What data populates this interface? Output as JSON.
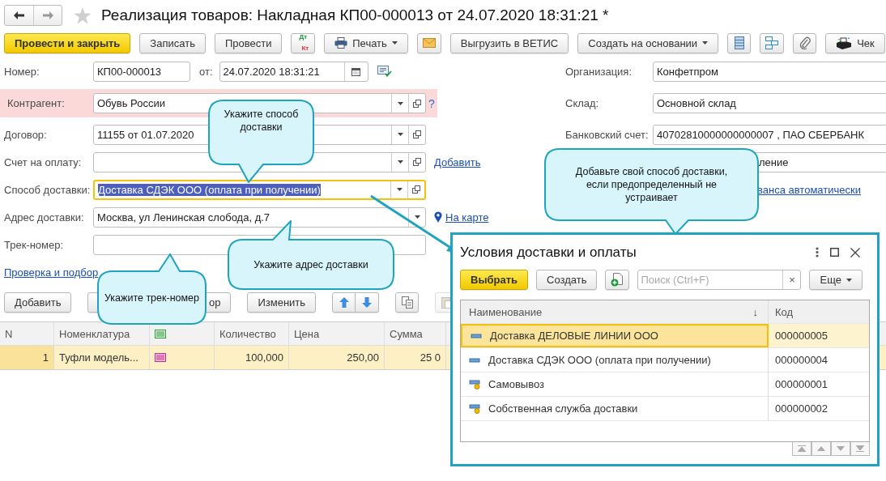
{
  "window": {
    "title": "Реализация товаров: Накладная КП00-000013 от 24.07.2020 18:31:21 *"
  },
  "toolbar": [
    {
      "kind": "primary",
      "label": "Провести и закрыть"
    },
    {
      "kind": "button",
      "label": "Записать"
    },
    {
      "kind": "button",
      "label": "Провести"
    },
    {
      "kind": "dtkt",
      "top": "Дт",
      "bottom": "Кт"
    },
    {
      "kind": "print",
      "label": "Печать"
    },
    {
      "kind": "mail"
    },
    {
      "kind": "button",
      "label": "Выгрузить в ВЕТИС"
    },
    {
      "kind": "menu",
      "label": "Создать на основании"
    },
    {
      "kind": "list"
    },
    {
      "kind": "structure"
    },
    {
      "kind": "clip"
    },
    {
      "kind": "receipt",
      "label": "Чек"
    }
  ],
  "number": {
    "label": "Номер:",
    "value": "КП00-000013",
    "date_label": "от:",
    "date": "24.07.2020 18:31:21"
  },
  "left_fields": [
    {
      "label": "Контрагент:",
      "value": "Обувь России",
      "kind": "choice",
      "error": true,
      "focused": false,
      "help": "?"
    },
    {
      "label": "Договор:",
      "value": "11155 от 01.07.2020",
      "kind": "choice",
      "error": false,
      "focused": false
    },
    {
      "label": "Счет на оплату:",
      "kind": "choice",
      "error": false,
      "focused": false,
      "link": "Добавить"
    },
    {
      "label": "Способ доставки:",
      "value": "Доставка СДЭК ООО (оплата при получении)",
      "kind": "choice",
      "error": false,
      "focused": true
    },
    {
      "label": "Адрес доставки:",
      "value": "Москва, ул Ленинская слобода, д.7",
      "kind": "address",
      "error": false,
      "focused": false,
      "link": "На карте"
    },
    {
      "label": "Трек-номер:",
      "kind": "text",
      "error": false,
      "focused": false
    }
  ],
  "check_link": "Проверка и подбор",
  "right_fields": [
    {
      "label": "Организация:",
      "value": "Конфетпром"
    },
    {
      "label": "Склад:",
      "value": "Основной склад"
    },
    {
      "label": "Банковский счет:",
      "value": "40702810000000000007 , ПАО СБЕРБАНК"
    },
    {
      "value": "ление"
    }
  ],
  "right_link": "ванса автоматически",
  "table_toolbar": [
    {
      "kind": "button",
      "label": "Добавить",
      "disabled": false
    },
    {
      "kind": "button",
      "label": "ор",
      "disabled": false
    },
    {
      "kind": "button",
      "label": "Изменить",
      "disabled": false
    },
    {
      "kind": "up",
      "disabled": false
    },
    {
      "kind": "down",
      "disabled": false
    },
    {
      "kind": "copy",
      "disabled": false
    },
    {
      "kind": "paste",
      "disabled": true
    }
  ],
  "table": {
    "columns": [
      {
        "kind": "index",
        "label": "N"
      },
      {
        "kind": "text",
        "label": "Номенклатура"
      },
      {
        "kind": "marking"
      },
      {
        "kind": "number",
        "label": "Количество"
      },
      {
        "kind": "number",
        "label": "Цена"
      },
      {
        "kind": "number",
        "label": "Сумма"
      }
    ],
    "rows": [
      {
        "selected": true,
        "cells": [
          "1",
          "Туфли модель...",
          "",
          "100,000",
          "250,00",
          "25 0"
        ]
      }
    ]
  },
  "dialog": {
    "title": "Условия доставки и оплаты",
    "buttons": [
      {
        "kind": "primary",
        "label": "Выбрать"
      },
      {
        "kind": "button",
        "label": "Создать"
      },
      {
        "kind": "add"
      }
    ],
    "search": {
      "placeholder": "Поиск (Ctrl+F)",
      "clear": "×"
    },
    "more": "Еще",
    "columns": [
      {
        "label": "Наименование",
        "sort": "↓"
      },
      {
        "label": "Код"
      }
    ],
    "rows": [
      {
        "name": "Доставка ДЕЛОВЫЕ ЛИНИИ ООО",
        "code": "000000005",
        "kind": "item",
        "selected": true
      },
      {
        "name": "Доставка СДЭК ООО (оплата при получении)",
        "code": "000000004",
        "kind": "item",
        "selected": false
      },
      {
        "name": "Самовывоз",
        "code": "000000001",
        "kind": "predefined",
        "selected": false
      },
      {
        "name": "Собственная служба доставки",
        "code": "000000002",
        "kind": "predefined",
        "selected": false
      }
    ]
  },
  "callouts": [
    {
      "text": "Укажите способ доставки"
    },
    {
      "text": "Добавьте свой способ доставки, если предопределенный не устраивает"
    },
    {
      "text": "Укажите адрес доставки"
    },
    {
      "text": "Укажите трек-номер"
    }
  ]
}
